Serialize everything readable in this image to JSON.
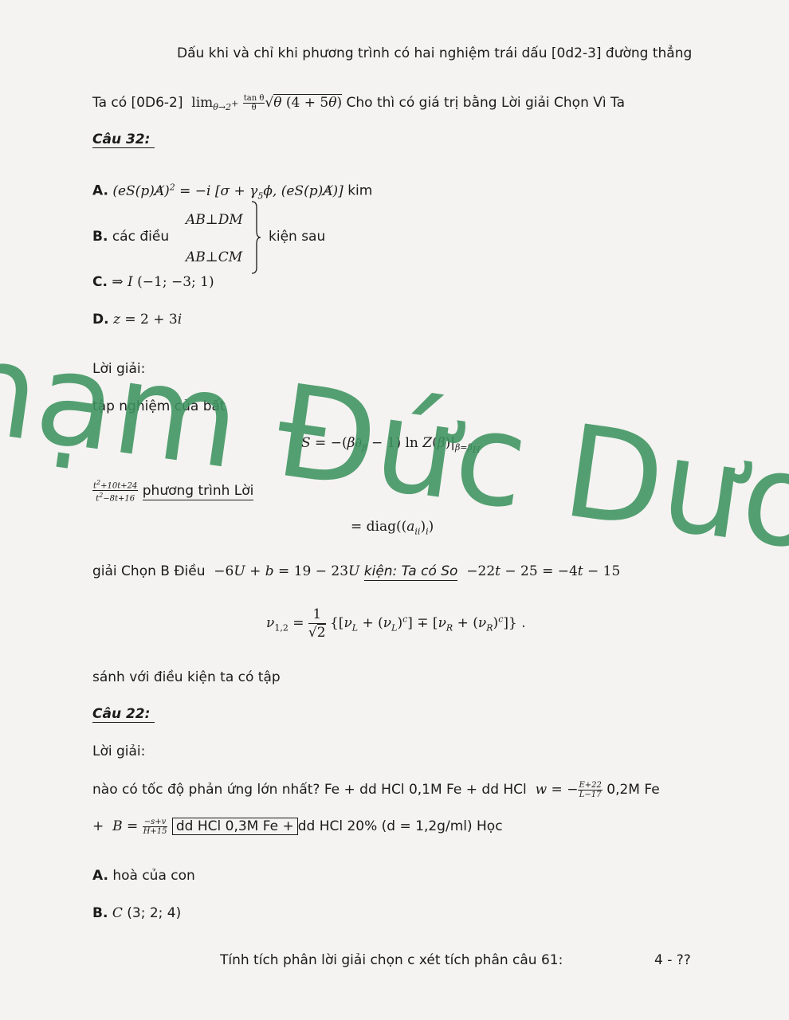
{
  "header": {
    "text": "Dấu khi và chỉ khi phương trình có hai nghiệm trái dấu [0d2-3] đường thẳng"
  },
  "line1": {
    "prefix": "Ta có [0D6-2]",
    "suffix": "Cho thì có giá trị bằng Lời giải Chọn Vì Ta"
  },
  "q32": {
    "heading": "Câu 32:",
    "optA_label": "A.",
    "optA_tail": "kim",
    "optB_label": "B.",
    "optB_text": "các điều",
    "optB_tail": "kiện sau",
    "optC_label": "C.",
    "optD_label": "D."
  },
  "sol1": {
    "label": "Lời giải:",
    "text1": "tập nghiệm của bất",
    "frac_text": "phương trình Lời",
    "line_prefix": "giải Chọn B Điều",
    "line_italic": "kiện: Ta có So",
    "text2": "sánh với điều kiện ta có tập"
  },
  "q22": {
    "heading": "Câu 22:",
    "sol_label": "Lời giải:",
    "line1_a": "nào có tốc độ phản ứng lớn nhất? Fe + dd HCl 0,1M Fe + dd HCl",
    "line1_b": "0,2M Fe",
    "line2_a": "+",
    "line2_box": "dd HCl 0,3M Fe +",
    "line2_b": "dd HCl 20% (d = 1,2g/ml) Học",
    "optA_label": "A.",
    "optA_text": "hoà của con",
    "optB_label": "B.",
    "optB_text": "(3; 2; 4)"
  },
  "footer": {
    "text": "Tính tích phân lời giải chọn c xét tích phân câu 61:",
    "page": "4 - ??"
  },
  "watermark": {
    "text": "hạm Đức Dươ"
  }
}
